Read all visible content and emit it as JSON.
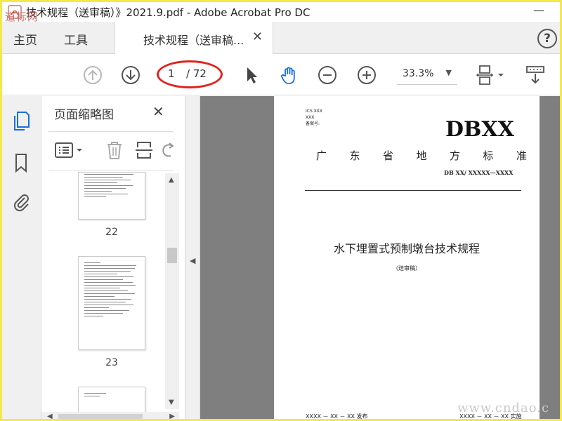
{
  "window": {
    "title": "技术规程（送审稿）》2021.9.pdf - Adobe Acrobat Pro DC",
    "minimize_glyph": "—"
  },
  "watermarks": {
    "top_left": "道标网",
    "bottom_right": "www.cndao.c"
  },
  "menu": {
    "home": "主页",
    "tools": "工具"
  },
  "tab": {
    "label": "技术规程（送审稿...",
    "close_glyph": "✕"
  },
  "help_glyph": "?",
  "toolbar": {
    "page_current": "1",
    "page_total": "/ 72",
    "zoom": "33.3%",
    "zoom_caret": "▼",
    "icons": [
      "prev-page-icon",
      "next-page-icon",
      "select-cursor-icon",
      "hand-tool-icon",
      "zoom-out-icon",
      "zoom-in-icon",
      "page-fit-icon",
      "scroll-mode-icon"
    ]
  },
  "rail": {
    "icons": [
      "page-thumbnails-icon",
      "bookmark-icon",
      "attachment-icon"
    ]
  },
  "thumbnails": {
    "title": "页面缩略图",
    "close_glyph": "✕",
    "pages": [
      {
        "number": "22"
      },
      {
        "number": "23"
      }
    ]
  },
  "scroll": {
    "up": "▲",
    "down": "▼",
    "left": "◀",
    "right": "▶",
    "collapse": "◀"
  },
  "document": {
    "ics_lines": [
      "ICS XXX",
      "XXX",
      "备案号:"
    ],
    "code": "DBXX",
    "standard_name": [
      "广",
      "东",
      "省",
      "地",
      "方",
      "标",
      "准"
    ],
    "standard_number": "DB XX/ XXXXX—XXXX",
    "title": "水下埋置式预制墩台技术规程",
    "subtitle": "（送审稿）",
    "issue_date": "XXXX － XX － XX 发布",
    "impl_date": "XXXX － XX － XX 实施"
  },
  "colors": {
    "acrobat_blue": "#1a6ee0",
    "annotation_red": "#e0231d",
    "border_yellow": "#f3e94a"
  }
}
